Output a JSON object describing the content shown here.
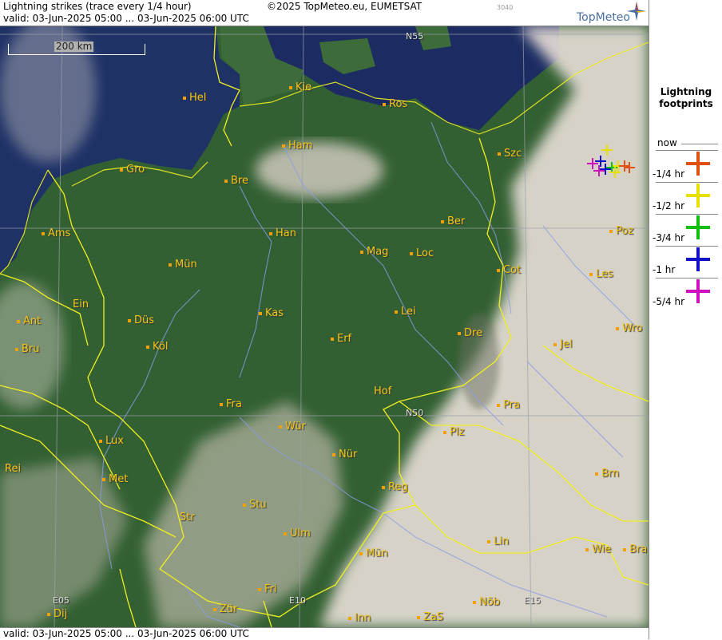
{
  "header": {
    "title": "Lightning strikes (trace every 1/4 hour)",
    "valid": "valid:  03-Jun-2025 05:00 ... 03-Jun-2025 06:00 UTC",
    "copyright": "©2025 TopMeteo.eu, EUMETSAT",
    "code": "3040",
    "logo": "TopMeteo"
  },
  "footer": {
    "valid": "valid:  03-Jun-2025 05:00 ... 03-Jun-2025 06:00 UTC"
  },
  "map": {
    "scale_label": "200 km",
    "grid_labels": [
      "N55",
      "N50",
      "E05",
      "E10",
      "E15"
    ],
    "cities": [
      "Hel",
      "Kie",
      "Ros",
      "Ham",
      "Szc",
      "Gro",
      "Bre",
      "Ber",
      "Ams",
      "Han",
      "Poz",
      "Mag",
      "Loc",
      "Mün",
      "Cot",
      "Les",
      "Ein",
      "Kas",
      "Lei",
      "Ant",
      "Düs",
      "Wro",
      "Bru",
      "Köl",
      "Erf",
      "Dre",
      "Jel",
      "Hof",
      "Fra",
      "Pra",
      "Lux",
      "Wür",
      "Plz",
      "Rei",
      "Nür",
      "Met",
      "Reg",
      "Brn",
      "Stu",
      "Str",
      "Ulm",
      "Lin",
      "Wie",
      "Bra",
      "Mün",
      "Fri",
      "Nöb",
      "Zür",
      "Dij",
      "Inn",
      "ZaS"
    ]
  },
  "legend": {
    "title_line1": "Lightning",
    "title_line2": "footprints",
    "rows": [
      {
        "label": "now",
        "color": ""
      },
      {
        "label": "-1/4 hr",
        "color": "#e05010"
      },
      {
        "label": "-1/2 hr",
        "color": "#e8e000"
      },
      {
        "label": "-3/4 hr",
        "color": "#10c010"
      },
      {
        "label": "-1 hr",
        "color": "#1010c8"
      },
      {
        "label": "-5/4 hr",
        "color": "#d010c0"
      }
    ]
  },
  "colors": {
    "border": "#f0f020",
    "river": "#8c9ce8",
    "sea": "#1c2a5a",
    "land": "#2e5a2e",
    "cloud": "#e6dcd4"
  }
}
